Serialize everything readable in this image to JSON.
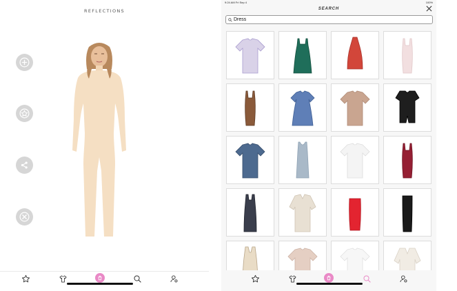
{
  "left_app": {
    "brand": "REFLECTIONS",
    "side_actions": [
      {
        "name": "add",
        "icon": "plus-icon"
      },
      {
        "name": "favorite",
        "icon": "star-icon"
      },
      {
        "name": "share",
        "icon": "share-icon"
      },
      {
        "name": "remove",
        "icon": "close-icon"
      }
    ],
    "tabbar": [
      "star-icon",
      "shirt-icon",
      "bag-icon",
      "search-icon",
      "profile-icon"
    ],
    "active_tab": 2
  },
  "right_app": {
    "status": {
      "time": "9:24 AM   Fri Sep 4",
      "battery": "100%"
    },
    "title": "SEARCH",
    "search": {
      "value": "Dress"
    },
    "results": [
      {
        "item": "oversized-tshirt-dress",
        "color": "#d9d2e8",
        "accent": "#a99ccf"
      },
      {
        "item": "satin-slip-dress",
        "color": "#1f6e5a",
        "accent": "#16503f"
      },
      {
        "item": "halter-mini-dress",
        "color": "#d2463a",
        "accent": "#a8322b"
      },
      {
        "item": "strappy-bodycon-dress",
        "color": "#f2dfe0",
        "accent": "#e2c8c9"
      },
      {
        "item": "printed-midi-dress",
        "color": "#8a5a3a",
        "accent": "#5f3c25"
      },
      {
        "item": "floral-puff-sleeve-dress",
        "color": "#5f7fb7",
        "accent": "#3f5f94"
      },
      {
        "item": "tshirt-dress-nude",
        "color": "#c9a590",
        "accent": "#b08b76"
      },
      {
        "item": "black-romper",
        "color": "#1e1e1e",
        "accent": "#000000"
      },
      {
        "item": "denim-tshirt-dress",
        "color": "#4d6a8f",
        "accent": "#384f6d"
      },
      {
        "item": "ribbed-tank-dress",
        "color": "#a9b9c8",
        "accent": "#8fa2b4"
      },
      {
        "item": "white-tshirt-dress",
        "color": "#f4f4f4",
        "accent": "#dddddd"
      },
      {
        "item": "burgundy-satin-dress",
        "color": "#951f33",
        "accent": "#6f1424"
      },
      {
        "item": "floral-maxi-dress",
        "color": "#3a3e4c",
        "accent": "#22252e"
      },
      {
        "item": "shirt-dress-beige",
        "color": "#e8e0d3",
        "accent": "#cfc4b3"
      },
      {
        "item": "red-bandeau-dress",
        "color": "#e32430",
        "accent": "#b0141e"
      },
      {
        "item": "black-strapless-maxi",
        "color": "#1a1a1a",
        "accent": "#000000"
      },
      {
        "item": "lace-up-knit-dress",
        "color": "#e9dcc6",
        "accent": "#b9a68a"
      },
      {
        "item": "nude-mini-dress",
        "color": "#e5cfc3",
        "accent": "#cdb3a6"
      },
      {
        "item": "white-tee-dress",
        "color": "#f7f7f7",
        "accent": "#e0e0e0"
      },
      {
        "item": "cream-wrap-dress",
        "color": "#f1ece4",
        "accent": "#d9d1c5"
      }
    ],
    "tabbar": [
      "star-icon",
      "shirt-icon",
      "bag-icon",
      "search-icon",
      "profile-icon"
    ],
    "active_tab": 2,
    "highlight_tab": 3
  },
  "colors": {
    "accent_pink": "#e989c6",
    "skin": "#f5dfc3",
    "side_button": "#d6d6d6"
  }
}
